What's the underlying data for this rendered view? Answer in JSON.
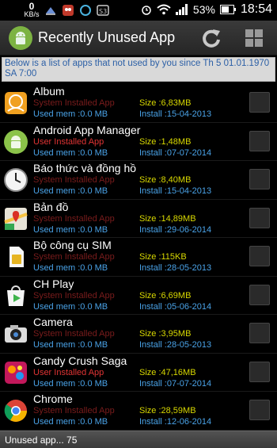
{
  "status_bar": {
    "speed_value": "0",
    "speed_unit": "KB/s",
    "battery_percent": "53%",
    "time": "18:54"
  },
  "app_bar": {
    "title": "Recently Unused App"
  },
  "info_text": "Below is a list of apps that not used by you since Th 5 01.01.1970 SA 7:00",
  "apps": [
    {
      "name": "Album",
      "type": "System Installed App",
      "size": "Size :6,83MB",
      "mem": "Used mem :0.0 MB",
      "install": "Install :15-04-2013"
    },
    {
      "name": "Android App Manager",
      "type": "User Installed App",
      "size": "Size :1,48MB",
      "mem": "Used mem :0.0 MB",
      "install": "Install :07-07-2014"
    },
    {
      "name": "Báo thức và đồng hồ",
      "type": "System Installed App",
      "size": "Size :8,40MB",
      "mem": "Used mem :0.0 MB",
      "install": "Install :15-04-2013"
    },
    {
      "name": "Bản đồ",
      "type": "System Installed App",
      "size": "Size :14,89MB",
      "mem": "Used mem :0.0 MB",
      "install": "Install :29-06-2014"
    },
    {
      "name": "Bộ công cụ SIM",
      "type": "System Installed App",
      "size": "Size :115KB",
      "mem": "Used mem :0.0 MB",
      "install": "Install :28-05-2013"
    },
    {
      "name": "CH Play",
      "type": "System Installed App",
      "size": "Size :6,69MB",
      "mem": "Used mem :0.0 MB",
      "install": "Install :05-06-2014"
    },
    {
      "name": "Camera",
      "type": "System Installed App",
      "size": "Size :3,95MB",
      "mem": "Used mem :0.0 MB",
      "install": "Install :28-05-2013"
    },
    {
      "name": "Candy Crush Saga",
      "type": "User Installed App",
      "size": "Size :47,16MB",
      "mem": "Used mem :0.0 MB",
      "install": "Install :07-07-2014"
    },
    {
      "name": "Chrome",
      "type": "System Installed App",
      "size": "Size :28,59MB",
      "mem": "Used mem :0.0 MB",
      "install": "Install :12-06-2014"
    }
  ],
  "footer": {
    "text": "Unused app... 75"
  }
}
